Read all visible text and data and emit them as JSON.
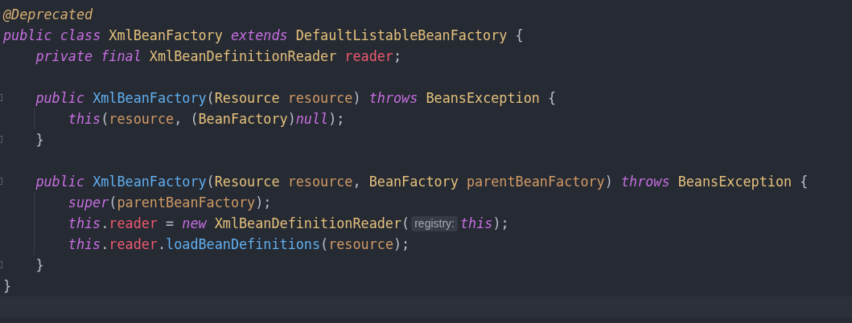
{
  "editor": {
    "lines": [
      {
        "kind": "code",
        "fold": false,
        "tokens": [
          {
            "kind": "annotation",
            "text": "@Deprecated"
          }
        ]
      },
      {
        "kind": "code",
        "fold": false,
        "tokens": [
          {
            "kind": "keyword",
            "text": "public class "
          },
          {
            "kind": "type",
            "text": "XmlBeanFactory "
          },
          {
            "kind": "keyword",
            "text": "extends "
          },
          {
            "kind": "type",
            "text": "DefaultListableBeanFactory "
          },
          {
            "kind": "punct",
            "text": "{"
          }
        ],
        "children": [
          {
            "kind": "code",
            "fold": false,
            "tokens": [
              {
                "kind": "keyword",
                "text": "private final "
              },
              {
                "kind": "type",
                "text": "XmlBeanDefinitionReader "
              },
              {
                "kind": "field",
                "text": "reader"
              },
              {
                "kind": "punct",
                "text": ";"
              }
            ]
          },
          {
            "kind": "blank",
            "fold": false
          },
          {
            "kind": "code",
            "fold": true,
            "tokens": [
              {
                "kind": "keyword",
                "text": "public "
              },
              {
                "kind": "method",
                "text": "XmlBeanFactory"
              },
              {
                "kind": "punct",
                "text": "("
              },
              {
                "kind": "type",
                "text": "Resource "
              },
              {
                "kind": "param",
                "text": "resource"
              },
              {
                "kind": "punct",
                "text": ") "
              },
              {
                "kind": "keyword",
                "text": "throws "
              },
              {
                "kind": "type",
                "text": "BeansException "
              },
              {
                "kind": "punct",
                "text": "{"
              }
            ],
            "children": [
              {
                "kind": "code",
                "fold": false,
                "tokens": [
                  {
                    "kind": "keyword",
                    "text": "this"
                  },
                  {
                    "kind": "punct",
                    "text": "("
                  },
                  {
                    "kind": "param",
                    "text": "resource"
                  },
                  {
                    "kind": "punct",
                    "text": ", ("
                  },
                  {
                    "kind": "type",
                    "text": "BeanFactory"
                  },
                  {
                    "kind": "punct",
                    "text": ")"
                  },
                  {
                    "kind": "keyword",
                    "text": "null"
                  },
                  {
                    "kind": "punct",
                    "text": ");"
                  }
                ]
              }
            ]
          },
          {
            "kind": "code",
            "fold": true,
            "tokens": [
              {
                "kind": "punct",
                "text": "}"
              }
            ]
          },
          {
            "kind": "blank",
            "fold": false
          },
          {
            "kind": "code",
            "fold": true,
            "tokens": [
              {
                "kind": "keyword",
                "text": "public "
              },
              {
                "kind": "method",
                "text": "XmlBeanFactory"
              },
              {
                "kind": "punct",
                "text": "("
              },
              {
                "kind": "type",
                "text": "Resource "
              },
              {
                "kind": "param",
                "text": "resource"
              },
              {
                "kind": "punct",
                "text": ", "
              },
              {
                "kind": "type",
                "text": "BeanFactory "
              },
              {
                "kind": "param",
                "text": "parentBeanFactory"
              },
              {
                "kind": "punct",
                "text": ") "
              },
              {
                "kind": "keyword",
                "text": "throws "
              },
              {
                "kind": "type",
                "text": "BeansException "
              },
              {
                "kind": "punct",
                "text": "{"
              }
            ],
            "children": [
              {
                "kind": "code",
                "fold": false,
                "tokens": [
                  {
                    "kind": "keyword",
                    "text": "super"
                  },
                  {
                    "kind": "punct",
                    "text": "("
                  },
                  {
                    "kind": "param",
                    "text": "parentBeanFactory"
                  },
                  {
                    "kind": "punct",
                    "text": ");"
                  }
                ]
              },
              {
                "kind": "code",
                "fold": false,
                "tokens": [
                  {
                    "kind": "keyword",
                    "text": "this"
                  },
                  {
                    "kind": "punct",
                    "text": "."
                  },
                  {
                    "kind": "field",
                    "text": "reader"
                  },
                  {
                    "kind": "punct",
                    "text": " = "
                  },
                  {
                    "kind": "keyword",
                    "text": "new "
                  },
                  {
                    "kind": "type",
                    "text": "XmlBeanDefinitionReader"
                  },
                  {
                    "kind": "punct",
                    "text": "("
                  },
                  {
                    "kind": "hint",
                    "text": "registry:"
                  },
                  {
                    "kind": "keyword",
                    "text": "this"
                  },
                  {
                    "kind": "punct",
                    "text": ");"
                  }
                ]
              },
              {
                "kind": "code",
                "fold": false,
                "tokens": [
                  {
                    "kind": "keyword",
                    "text": "this"
                  },
                  {
                    "kind": "punct",
                    "text": "."
                  },
                  {
                    "kind": "field",
                    "text": "reader"
                  },
                  {
                    "kind": "punct",
                    "text": "."
                  },
                  {
                    "kind": "method",
                    "text": "loadBeanDefinitions"
                  },
                  {
                    "kind": "punct",
                    "text": "("
                  },
                  {
                    "kind": "param",
                    "text": "resource"
                  },
                  {
                    "kind": "punct",
                    "text": ");"
                  }
                ]
              }
            ]
          },
          {
            "kind": "code",
            "fold": true,
            "tokens": [
              {
                "kind": "punct",
                "text": "}"
              }
            ]
          }
        ]
      },
      {
        "kind": "code",
        "fold": false,
        "tokens": [
          {
            "kind": "punct",
            "text": "}"
          }
        ]
      },
      {
        "kind": "blank",
        "fold": false
      }
    ]
  }
}
